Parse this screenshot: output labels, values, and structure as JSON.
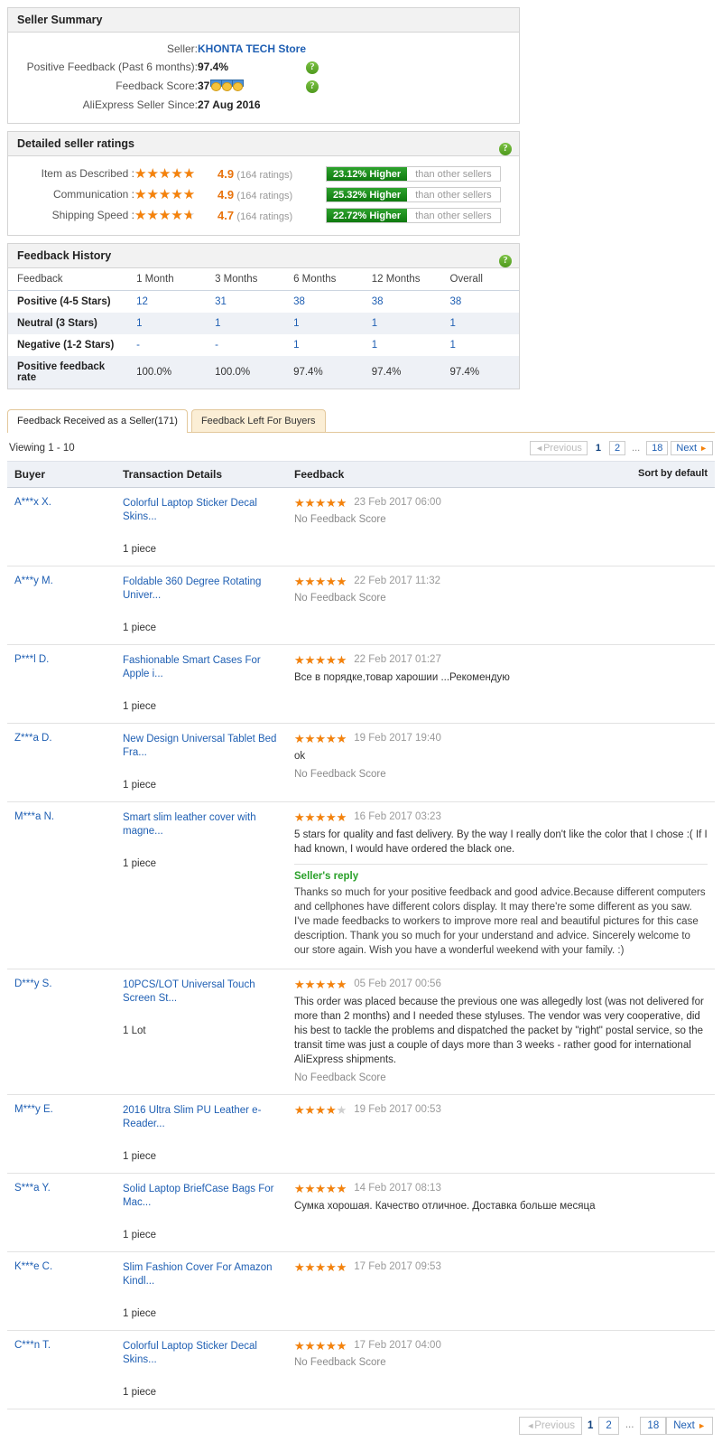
{
  "seller_summary": {
    "title": "Seller Summary",
    "rows": [
      {
        "label": "Seller:",
        "value": "KHONTA TECH Store",
        "type": "link",
        "help": false
      },
      {
        "label": "Positive Feedback (Past 6 months):",
        "value": "97.4%",
        "type": "text",
        "help": true
      },
      {
        "label": "Feedback Score:",
        "value": "37",
        "type": "medals",
        "medals": 3,
        "help": true
      },
      {
        "label": "AliExpress Seller Since:",
        "value": "27 Aug 2016",
        "type": "text",
        "help": false
      }
    ]
  },
  "detailed_ratings": {
    "title": "Detailed seller ratings",
    "rows": [
      {
        "label": "Item as Described :",
        "score": "4.9",
        "stars": 4.9,
        "count": "(164 ratings)",
        "compare": "23.12% Higher",
        "compare_base": "than other sellers"
      },
      {
        "label": "Communication :",
        "score": "4.9",
        "stars": 4.9,
        "count": "(164 ratings)",
        "compare": "25.32% Higher",
        "compare_base": "than other sellers"
      },
      {
        "label": "Shipping Speed :",
        "score": "4.7",
        "stars": 4.7,
        "count": "(164 ratings)",
        "compare": "22.72% Higher",
        "compare_base": "than other sellers"
      }
    ]
  },
  "feedback_history": {
    "title": "Feedback History",
    "headers": [
      "Feedback",
      "1 Month",
      "3 Months",
      "6 Months",
      "12 Months",
      "Overall"
    ],
    "rows": [
      {
        "name": "Positive (4-5 Stars)",
        "values": [
          "12",
          "31",
          "38",
          "38",
          "38"
        ]
      },
      {
        "name": "Neutral (3 Stars)",
        "values": [
          "1",
          "1",
          "1",
          "1",
          "1"
        ]
      },
      {
        "name": "Negative (1-2 Stars)",
        "values": [
          "-",
          "-",
          "1",
          "1",
          "1"
        ]
      },
      {
        "name": "Positive feedback rate",
        "values": [
          "100.0%",
          "100.0%",
          "97.4%",
          "97.4%",
          "97.4%"
        ]
      }
    ]
  },
  "tabs": [
    {
      "label": "Feedback Received as a Seller(171)",
      "active": true
    },
    {
      "label": "Feedback Left For Buyers",
      "active": false
    }
  ],
  "viewing": "Viewing 1 - 10",
  "pagination": {
    "previous": "Previous",
    "next": "Next",
    "ellipsis": "...",
    "pages": [
      "1",
      "2",
      "18"
    ],
    "current": "1"
  },
  "feedback_table": {
    "headers": {
      "buyer": "Buyer",
      "transaction": "Transaction Details",
      "feedback": "Feedback",
      "sort": "Sort by default"
    },
    "rows": [
      {
        "buyer": "A***x X.",
        "product": "Colorful Laptop Sticker Decal Skins...",
        "qty": "1 piece",
        "stars": 5,
        "date": "23 Feb 2017 06:00",
        "text": "",
        "no_score": "No Feedback Score",
        "reply_title": "",
        "reply": ""
      },
      {
        "buyer": "A***y M.",
        "product": "Foldable 360 Degree Rotating Univer...",
        "qty": "1 piece",
        "stars": 5,
        "date": "22 Feb 2017 11:32",
        "text": "",
        "no_score": "No Feedback Score",
        "reply_title": "",
        "reply": ""
      },
      {
        "buyer": "P***l D.",
        "product": "Fashionable Smart Cases For Apple i...",
        "qty": "1 piece",
        "stars": 5,
        "date": "22 Feb 2017 01:27",
        "text": "Все в порядке,товар харошии ...Рекомендую",
        "no_score": "",
        "reply_title": "",
        "reply": ""
      },
      {
        "buyer": "Z***a D.",
        "product": "New Design Universal Tablet Bed Fra...",
        "qty": "1 piece",
        "stars": 5,
        "date": "19 Feb 2017 19:40",
        "text": "ok",
        "no_score": "No Feedback Score",
        "reply_title": "",
        "reply": ""
      },
      {
        "buyer": "M***a N.",
        "product": "Smart slim leather cover with magne...",
        "qty": "1 piece",
        "stars": 5,
        "date": "16 Feb 2017 03:23",
        "text": "5 stars for quality and fast delivery. By the way I really don't like the color that I chose :( If I had known, I would have ordered the black one.",
        "no_score": "",
        "reply_title": "Seller's reply",
        "reply": "Thanks so much for your positive feedback and good advice.Because different computers and cellphones have different colors display. It may there're some different as you saw. I've made feedbacks to workers to improve more real and beautiful pictures for this case description. Thank you so much for your understand and advice. Sincerely welcome to our store again. Wish you have a wonderful weekend with your family. :)"
      },
      {
        "buyer": "D***y S.",
        "product": "10PCS/LOT Universal Touch Screen St...",
        "qty": "1 Lot",
        "stars": 5,
        "date": "05 Feb 2017 00:56",
        "text": "This order was placed because the previous one was allegedly lost (was not delivered for more than 2 months) and I needed these styluses. The vendor was very cooperative, did his best to tackle the problems and dispatched the packet by \"right\" postal service, so the transit time was just a couple of days more than 3 weeks - rather good for international AliExpress shipments.",
        "no_score": "No Feedback Score",
        "reply_title": "",
        "reply": ""
      },
      {
        "buyer": "M***y E.",
        "product": "2016 Ultra Slim PU Leather e-Reader...",
        "qty": "1 piece",
        "stars": 4,
        "date": "19 Feb 2017 00:53",
        "text": "",
        "no_score": "",
        "reply_title": "",
        "reply": ""
      },
      {
        "buyer": "S***a Y.",
        "product": "Solid Laptop BriefCase Bags For Mac...",
        "qty": "1 piece",
        "stars": 5,
        "date": "14 Feb 2017 08:13",
        "text": "Сумка хорошая. Качество отличное. Доставка больше месяца",
        "no_score": "",
        "reply_title": "",
        "reply": ""
      },
      {
        "buyer": "K***e C.",
        "product": "Slim Fashion Cover For Amazon Kindl...",
        "qty": "1 piece",
        "stars": 5,
        "date": "17 Feb 2017 09:53",
        "text": "",
        "no_score": "",
        "reply_title": "",
        "reply": ""
      },
      {
        "buyer": "C***n T.",
        "product": "Colorful Laptop Sticker Decal Skins...",
        "qty": "1 piece",
        "stars": 5,
        "date": "17 Feb 2017 04:00",
        "text": "",
        "no_score": "No Feedback Score",
        "reply_title": "",
        "reply": ""
      }
    ]
  },
  "colors": {
    "link": "#1f5fb3",
    "star": "#f5820b",
    "star_empty": "#cfcfcf",
    "green_bar": "#1a8a1a",
    "reply_green": "#2aa02a",
    "tab_bg": "#fbeed5",
    "panel_head": "#f2f2f2"
  }
}
